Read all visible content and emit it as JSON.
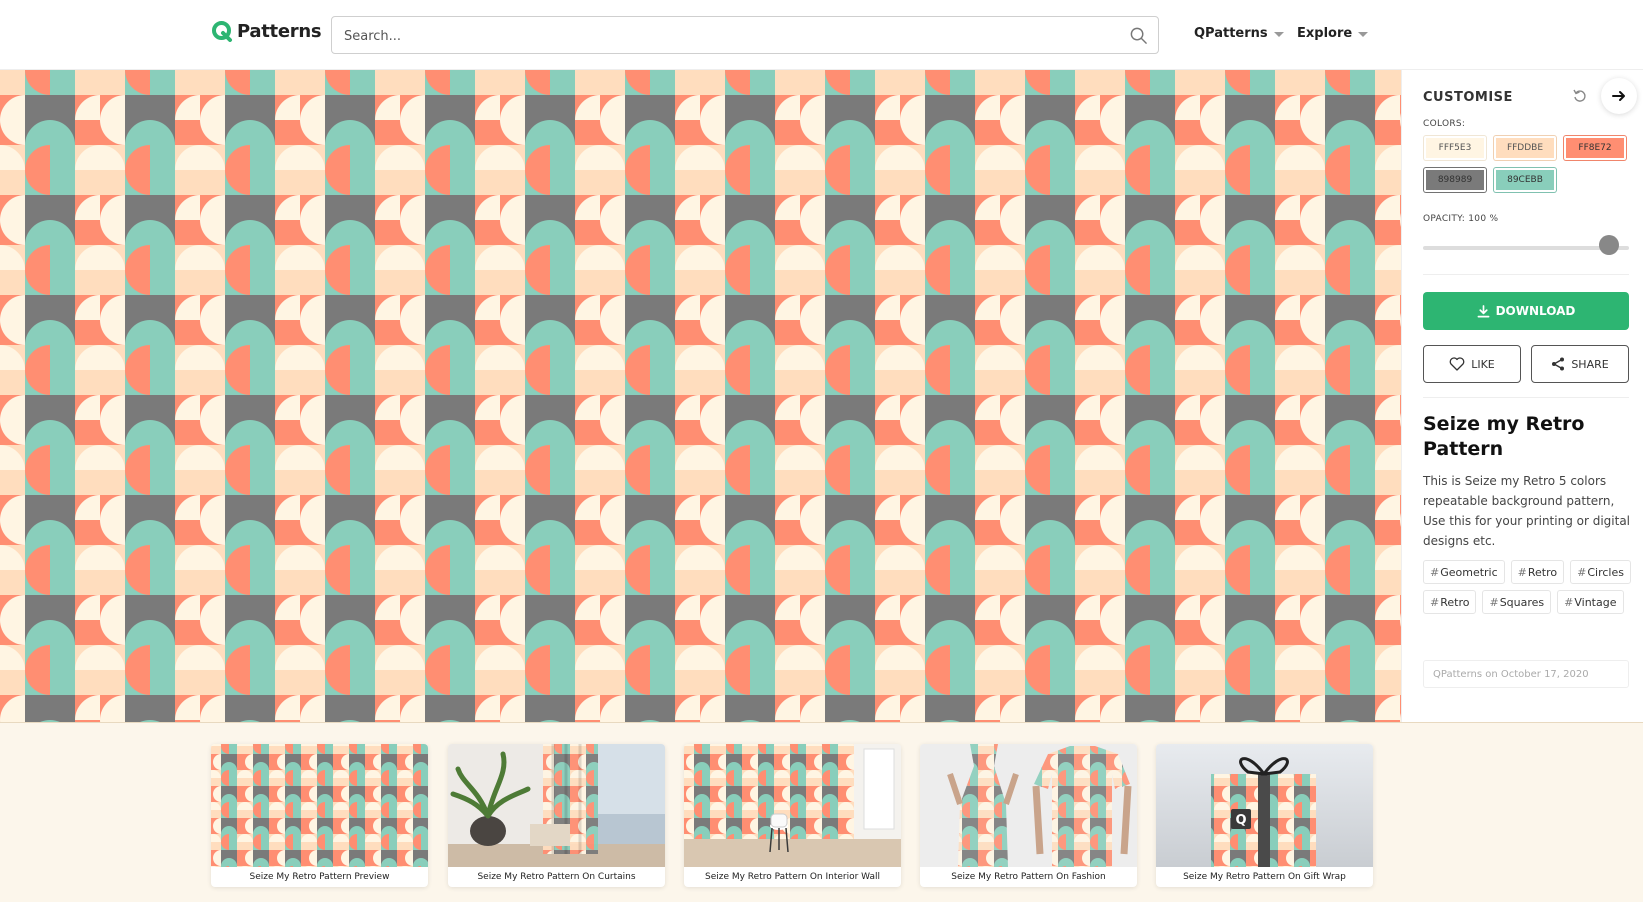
{
  "header": {
    "logo_letter": "Q",
    "logo_text": "Patterns",
    "search_placeholder": "Search...",
    "nav": [
      {
        "label": "QPatterns"
      },
      {
        "label": "Explore"
      }
    ]
  },
  "sidebar": {
    "title": "CUSTOMISE",
    "colors_label": "COLORS:",
    "colors": [
      {
        "label": "FFF5E3",
        "hex": "#FFF5E3"
      },
      {
        "label": "FFDDBE",
        "hex": "#FFDDBE"
      },
      {
        "label": "FF8E72",
        "hex": "#FF8E72"
      },
      {
        "label": "898989",
        "hex": "#898989"
      },
      {
        "label": "89CEBB",
        "hex": "#89CEBB"
      }
    ],
    "opacity_label": "OPACITY: 100 %",
    "opacity_value": 1.0,
    "download_label": "DOWNLOAD",
    "like_label": "LIKE",
    "share_label": "SHARE",
    "pattern_title": "Seize my Retro Pattern",
    "description": "This is Seize my Retro 5 colors repeatable background pattern, Use this for your printing or digital designs etc.",
    "tags": [
      "Geometric",
      "Retro",
      "Circles",
      "Retro",
      "Squares",
      "Vintage"
    ],
    "credit": "QPatterns on October 17, 2020"
  },
  "previews": [
    {
      "caption": "Seize My Retro Pattern Preview",
      "icon": "pattern-preview-image"
    },
    {
      "caption": "Seize My Retro Pattern On Curtains",
      "icon": "curtains-mockup-image"
    },
    {
      "caption": "Seize My Retro Pattern On Interior Wall",
      "icon": "interior-wall-mockup-image"
    },
    {
      "caption": "Seize My Retro Pattern On Fashion",
      "icon": "fashion-mockup-image"
    },
    {
      "caption": "Seize My Retro Pattern On Gift Wrap",
      "icon": "gift-wrap-mockup-image"
    }
  ],
  "theme": {
    "brand_green": "#2DB572",
    "pattern_cream": "#FFF5E3",
    "pattern_peach": "#FFDDBE",
    "pattern_coral": "#FF8E72",
    "pattern_grey": "#7A7A7A",
    "pattern_teal": "#89CEBB"
  }
}
